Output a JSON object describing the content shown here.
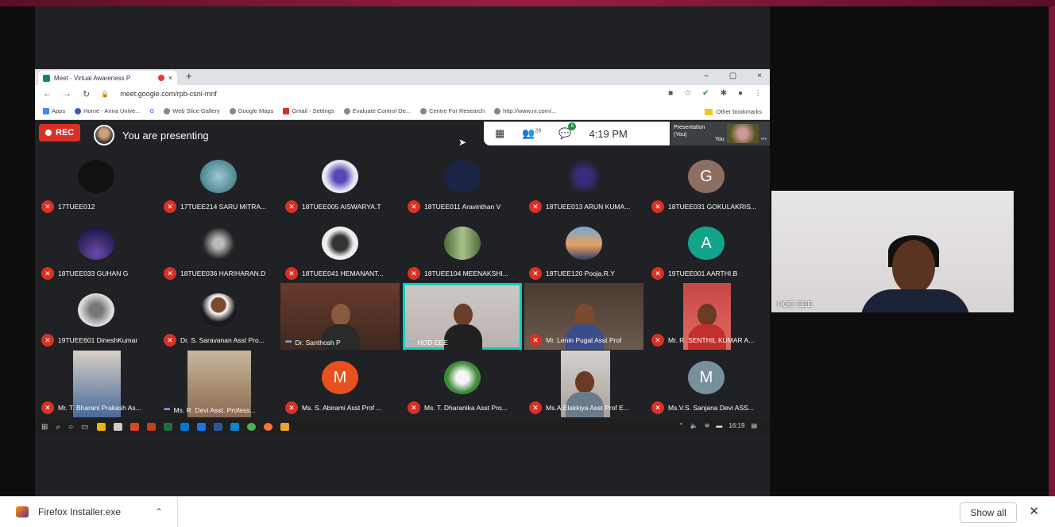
{
  "browser": {
    "tab_title": "Meet - Virtual Awareness P",
    "tab_close": "×",
    "new_tab": "+",
    "window_buttons": [
      "–",
      "▢",
      "×"
    ],
    "url": "meet.google.com/rpb-csni-mnf",
    "bookmarks": [
      "Apps",
      "Home - Anna Unive...",
      "G",
      "Web Slice Gallery",
      "Google Maps",
      "Gmail - Settings",
      "Evaluate Control De...",
      "Centre For Research",
      "http://www.ni.com/..."
    ],
    "other_bookmarks": "Other bookmarks"
  },
  "meet": {
    "rec_label": "REC",
    "presenting_text": "You are presenting",
    "participant_count": "28",
    "chat_badge": "8",
    "time": "4:19 PM",
    "presentation_label": "Presentation (You)",
    "presentation_you": "You"
  },
  "participants": [
    {
      "name": "17TUEE012",
      "initial": ""
    },
    {
      "name": "17TUEE214 SARU MITRA...",
      "initial": ""
    },
    {
      "name": "18TUEE005 AISWARYA.T",
      "initial": ""
    },
    {
      "name": "18TUEE011 Aravinthan V",
      "initial": ""
    },
    {
      "name": "18TUEE013 ARUN KUMA...",
      "initial": ""
    },
    {
      "name": "18TUEE031 GOKULAKRIS...",
      "initial": "G"
    },
    {
      "name": "18TUEE033 GUHAN G",
      "initial": ""
    },
    {
      "name": "18TUEE036 HARIHARAN.D",
      "initial": ""
    },
    {
      "name": "18TUEE041 HEMANANT...",
      "initial": ""
    },
    {
      "name": "18TUEE104 MEENAKSHI...",
      "initial": ""
    },
    {
      "name": "18TUEE120 Pooja.R.Y",
      "initial": ""
    },
    {
      "name": "19TUEE001 AARTHI.B",
      "initial": "A"
    },
    {
      "name": "19TUEE601 DineshKumar",
      "initial": ""
    },
    {
      "name": "Dr. S. Saravanan Asst Pro...",
      "initial": ""
    },
    {
      "name": "Dr. Santhosh P",
      "initial": ""
    },
    {
      "name": "HOD EEE",
      "initial": ""
    },
    {
      "name": "Mr. Lenin Pugal Asst Prof",
      "initial": ""
    },
    {
      "name": "Mr. R. SENTHIL KUMAR A...",
      "initial": ""
    },
    {
      "name": "Mr. T. Bharani Prakash As...",
      "initial": ""
    },
    {
      "name": "Ms. R. Devi Asst. Profess...",
      "initial": ""
    },
    {
      "name": "Ms. S. Abirami Asst Prof ...",
      "initial": "M"
    },
    {
      "name": "Ms. T. Dharanika Asst Pro...",
      "initial": ""
    },
    {
      "name": "Ms.A.Elakkiya Asst Prof E...",
      "initial": ""
    },
    {
      "name": "Ms.V.S. Sanjana Devi ASS...",
      "initial": "M"
    }
  ],
  "side_tile": {
    "name": "HOD EEE"
  },
  "taskbar": {
    "time": "16:19"
  },
  "download": {
    "file_name": "Firefox Installer.exe",
    "show_all": "Show all",
    "close": "✕"
  },
  "colors": {
    "rec": "#d93025",
    "active_outline": "#00d1c1",
    "mic_off": "#d93025"
  }
}
